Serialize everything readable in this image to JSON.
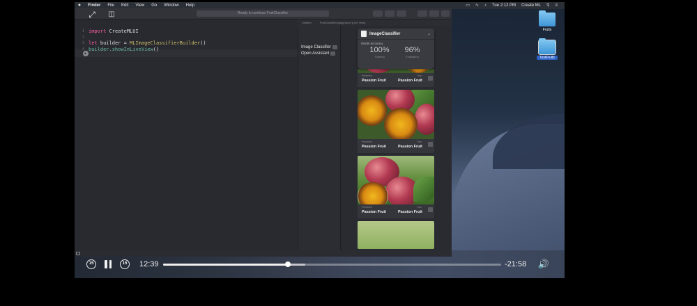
{
  "menubar": {
    "app": "Finder",
    "items": [
      "File",
      "Edit",
      "View",
      "Go",
      "Window",
      "Help"
    ],
    "clock": "Tue 2:12 PM",
    "right_app": "Create ML"
  },
  "desktop": {
    "icons": [
      {
        "label": "Fruits"
      },
      {
        "label": "TestFruits"
      }
    ]
  },
  "xcode": {
    "status": "Ready to continue FruitClassifier",
    "tabs": [
      "Untitled",
      "FruitClassifier.playground (Live View)"
    ],
    "code": [
      {
        "n": "1",
        "kw": "import",
        "rest": " CreateMLUI",
        "type": "",
        "fn": "",
        "tail": ""
      },
      {
        "n": "2",
        "kw": "",
        "rest": "",
        "type": "",
        "fn": "",
        "tail": ""
      },
      {
        "n": "3",
        "kw": "let",
        "rest": " builder = ",
        "type": "MLImageClassifierBuilder",
        "fn": "",
        "tail": "()"
      },
      {
        "n": "4",
        "kw": "",
        "rest": "builder.",
        "type": "",
        "fn": "showInLiveView",
        "tail": "()"
      }
    ],
    "results": [
      "Image Classifier",
      "Open Assistant"
    ]
  },
  "classifier": {
    "title": "ImageClassifier",
    "accuracy_label": "Model accuracy",
    "training_value": "100%",
    "training_caption": "Training",
    "evaluation_value": "96%",
    "evaluation_caption": "Evaluation"
  },
  "feed": {
    "predicted_tag": "Predicted",
    "true_tag": "True",
    "rows": [
      {
        "predicted": "Passion Fruit",
        "true": "Passion Fruit"
      },
      {
        "predicted": "Passion Fruit",
        "true": "Passion Fruit"
      },
      {
        "predicted": "Passion Fruit",
        "true": "Passion Fruit"
      }
    ]
  },
  "player": {
    "elapsed": "12:39",
    "remaining": "-21:58",
    "skip_back": "15",
    "skip_forward": "15",
    "progress": 0.37,
    "buffered": 0.42
  }
}
